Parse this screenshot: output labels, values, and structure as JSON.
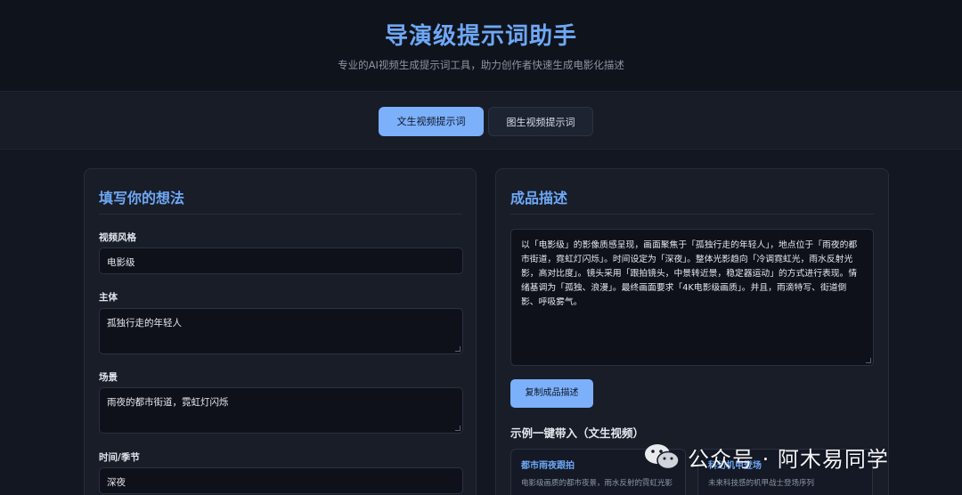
{
  "header": {
    "title": "导演级提示词助手",
    "subtitle": "专业的AI视频生成提示词工具，助力创作者快速生成电影化描述"
  },
  "tabs": [
    {
      "label": "文生视频提示词",
      "active": true
    },
    {
      "label": "图生视频提示词",
      "active": false
    }
  ],
  "left_panel": {
    "title": "填写你的想法",
    "fields": [
      {
        "label": "视频风格",
        "value": "电影级"
      },
      {
        "label": "主体",
        "value": "孤独行走的年轻人"
      },
      {
        "label": "场景",
        "value": "雨夜的都市街道，霓虹灯闪烁"
      },
      {
        "label": "时间/季节",
        "value": "深夜"
      }
    ]
  },
  "right_panel": {
    "title": "成品描述",
    "output_text": "以「电影级」的影像质感呈现，画面聚焦于「孤独行走的年轻人」，地点位于「雨夜的都市街道，霓虹灯闪烁」。时间设定为「深夜」。整体光影趋向「冷调霓虹光，雨水反射光影，高对比度」。镜头采用「跟拍镜头，中景转近景，稳定器运动」的方式进行表现。情绪基调为「孤独、浪漫」。最终画面要求「4K电影级画质」。并且，雨滴特写、街道倒影、呼吸雾气。",
    "copy_label": "复制成品描述",
    "examples_title": "示例一键带入（文生视频）",
    "examples": [
      {
        "title": "都市雨夜跟拍",
        "desc": "电影级画质的都市夜景，雨水反射的霓虹光影"
      },
      {
        "title": "科幻机甲登场",
        "desc": "未来科技感的机甲战士登场序列"
      }
    ]
  },
  "watermark": {
    "text": "公众号 · 阿木易同学"
  },
  "colors": {
    "accent": "#6ea8f5",
    "button": "#7cb0fb",
    "background": "#121722",
    "panel": "#181d28"
  }
}
